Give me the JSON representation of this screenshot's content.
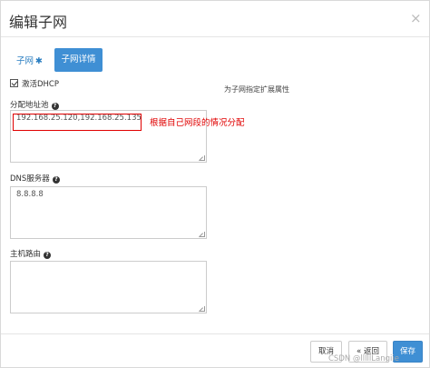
{
  "dialog": {
    "title": "编辑子网",
    "close_icon": "close-icon"
  },
  "tabs": {
    "subnet_label": "子网",
    "subnet_star": "✱",
    "detail_label": "子网详情"
  },
  "dhcp": {
    "label": "激活DHCP",
    "checked": true
  },
  "help_text": "为子网指定扩展属性",
  "pool": {
    "label": "分配地址池",
    "value": "192.168.25.120,192.168.25.135"
  },
  "annotation": "根据自己网段的情况分配",
  "dns": {
    "label": "DNS服务器",
    "value": "8.8.8.8"
  },
  "host_routes": {
    "label": "主机路由",
    "value": ""
  },
  "buttons": {
    "cancel": "取消",
    "back": "« 返回",
    "save": "保存"
  },
  "watermark": "CSDN @lllllLangiie",
  "colors": {
    "accent": "#3f8fd4",
    "annotation_red": "#e00000"
  }
}
